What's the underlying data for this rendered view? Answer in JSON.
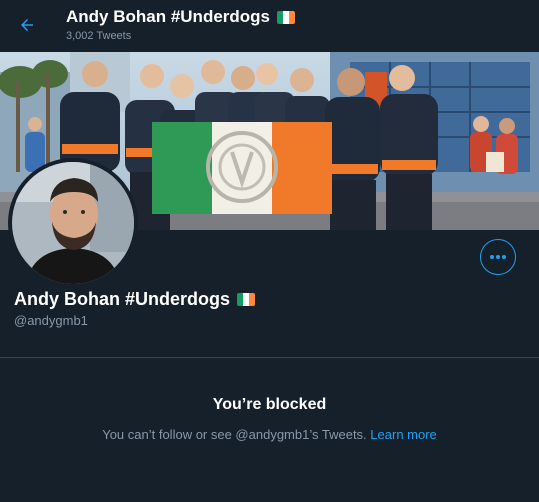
{
  "header": {
    "title": "Andy Bohan #Underdogs",
    "tweet_count": "3,002 Tweets",
    "back_icon": "arrow-left-icon"
  },
  "profile": {
    "display_name": "Andy Bohan #Underdogs",
    "handle": "@andygmb1",
    "flag_icon": "ireland-flag-icon",
    "more_icon": "more-options-icon"
  },
  "blocked": {
    "title": "You’re blocked",
    "message": "You can’t follow or see @andygmb1’s Tweets.",
    "link": "Learn more"
  },
  "colors": {
    "background": "#15202b",
    "accent": "#1da1f2",
    "secondary_text": "#8899a6",
    "divider": "#38444d"
  }
}
